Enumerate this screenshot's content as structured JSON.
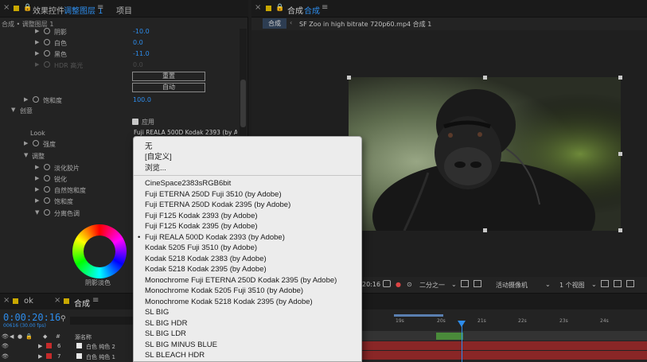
{
  "left_panel": {
    "tabs": [
      {
        "label": "效果控件",
        "active": false
      },
      {
        "label": "调整图层 1",
        "active": true
      },
      {
        "label": "项目",
        "active": false
      }
    ],
    "path": "合成 • 调整图层 1",
    "rows": [
      {
        "label": "阴影",
        "value": "-10.0"
      },
      {
        "label": "白色",
        "value": "0.0"
      },
      {
        "label": "黑色",
        "value": "-11.0"
      },
      {
        "label": "HDR 高光",
        "value": "0.0"
      }
    ],
    "reset_label": "重置",
    "auto_label": "自动",
    "saturation_label": "饱和度",
    "saturation_value": "100.0",
    "creative_label": "创意",
    "apply_label": "应用",
    "look_label": "Look",
    "look_value": "Fuji REALA 500D Kodak 2393 (by A:",
    "strength_label": "强度",
    "adjust_label": "调整",
    "sub_rows": [
      "淡化胶片",
      "锐化",
      "自然饱和度",
      "饱和度",
      "分离色调"
    ],
    "wheel_label": "阴影淡色"
  },
  "right_panel": {
    "tab_label": "合成",
    "tab_active": "合成",
    "chip_label": "合成",
    "crumb": "SF Zoo in high bitrate 720p60.mp4 合成 1"
  },
  "viewer_toolbar": {
    "time": "20:16",
    "resolution": "二分之一",
    "camera": "活动摄像机",
    "views": "1 个视图"
  },
  "timeline": {
    "tabs": [
      "ok",
      "合成"
    ],
    "timecode": "0:00:20:16",
    "fps": "00616 (30.00 fps)",
    "col_header": "源名称",
    "col_number": "#",
    "layers": [
      {
        "num": "6",
        "name": "白色 纯色 2"
      },
      {
        "num": "7",
        "name": "白色 纯色 1"
      }
    ],
    "ticks": [
      "19s",
      "20s",
      "21s",
      "22s",
      "23s",
      "24s"
    ]
  },
  "menu": {
    "items_top": [
      "无",
      "[自定义]",
      "浏览..."
    ],
    "items": [
      "CineSpace2383sRGB6bit",
      "Fuji ETERNA 250D Fuji 3510 (by Adobe)",
      "Fuji ETERNA 250D Kodak 2395 (by Adobe)",
      "Fuji F125 Kodak 2393 (by Adobe)",
      "Fuji F125 Kodak 2395 (by Adobe)",
      "Fuji REALA 500D Kodak 2393 (by Adobe)",
      "Kodak 5205 Fuji 3510 (by Adobe)",
      "Kodak 5218 Kodak 2383 (by Adobe)",
      "Kodak 5218 Kodak 2395 (by Adobe)",
      "Monochrome Fuji ETERNA 250D Kodak 2395 (by Adobe)",
      "Monochrome Kodak 5205 Fuji 3510 (by Adobe)",
      "Monochrome Kodak 5218 Kodak 2395 (by Adobe)",
      "SL BIG",
      "SL BIG HDR",
      "SL BIG LDR",
      "SL BIG MINUS BLUE",
      "SL BLEACH HDR"
    ],
    "checked_index": 5
  },
  "colors": {
    "accent": "#2d8ceb",
    "panel": "#232323",
    "menu_bg": "#ececec",
    "layer_red": "#c62b2b"
  }
}
